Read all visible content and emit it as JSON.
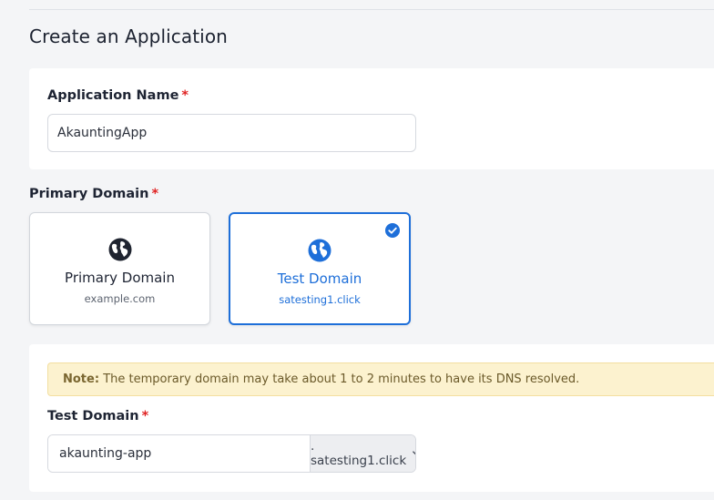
{
  "page": {
    "title": "Create an Application"
  },
  "app_section": {
    "label": "Application Name",
    "required_mark": "*",
    "input_value": "AkauntingApp"
  },
  "primary_domain_section": {
    "label": "Primary Domain",
    "required_mark": "*",
    "options": [
      {
        "title": "Primary Domain",
        "subtitle": "example.com",
        "icon": "globe-icon",
        "selected": false
      },
      {
        "title": "Test Domain",
        "subtitle": "satesting1.click",
        "icon": "globe-icon",
        "selected": true
      }
    ]
  },
  "test_domain_section": {
    "note_prefix": "Note:",
    "note_text": "The temporary domain may take about 1 to 2 minutes to have its DNS resolved.",
    "label": "Test Domain",
    "required_mark": "*",
    "subdomain_value": "akaunting-app",
    "suffix_value": ". satesting1.click"
  },
  "colors": {
    "accent": "#1e6fd9",
    "required": "#e02424",
    "note_bg": "#fcf2cf"
  }
}
